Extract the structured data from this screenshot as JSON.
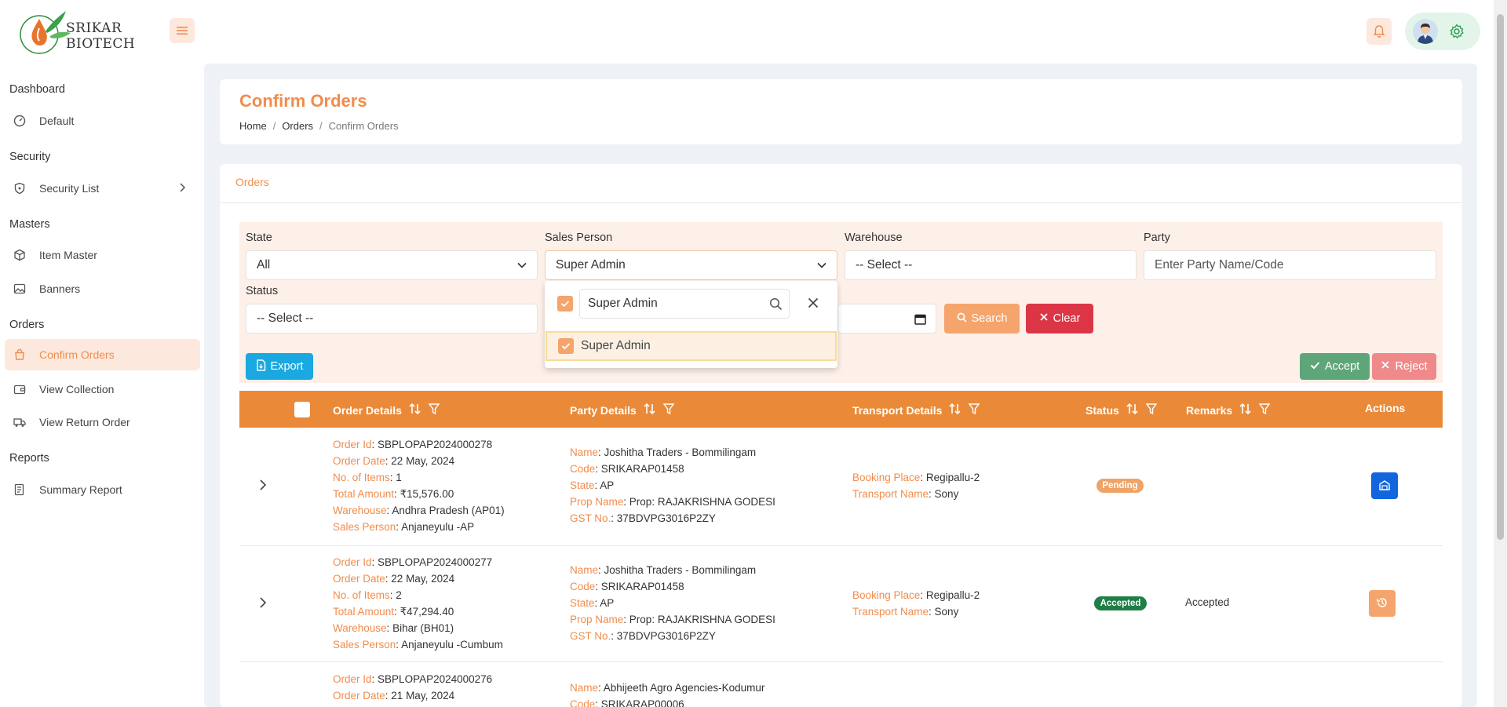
{
  "brand": {
    "line1": "SRIKAR",
    "line2": "BIOTECH"
  },
  "sidebar": {
    "sections": [
      {
        "title": "Dashboard",
        "items": [
          {
            "label": "Default",
            "icon": "gauge-icon"
          }
        ]
      },
      {
        "title": "Security",
        "items": [
          {
            "label": "Security List",
            "icon": "shield-icon"
          }
        ]
      },
      {
        "title": "Masters",
        "items": [
          {
            "label": "Item Master",
            "icon": "box-icon"
          },
          {
            "label": "Banners",
            "icon": "image-icon"
          }
        ]
      },
      {
        "title": "Orders",
        "items": [
          {
            "label": "Confirm Orders",
            "icon": "bag-icon"
          },
          {
            "label": "View Collection",
            "icon": "wallet-icon"
          },
          {
            "label": "View Return Order",
            "icon": "truck-icon"
          }
        ]
      },
      {
        "title": "Reports",
        "items": [
          {
            "label": "Summary Report",
            "icon": "report-icon"
          }
        ]
      }
    ]
  },
  "page": {
    "title": "Confirm Orders",
    "breadcrumb": [
      "Home",
      "Orders",
      "Confirm Orders"
    ],
    "card_title": "Orders"
  },
  "filters": {
    "state": {
      "label": "State",
      "value": "All"
    },
    "sales_person": {
      "label": "Sales Person",
      "value": "Super Admin"
    },
    "warehouse": {
      "label": "Warehouse",
      "value": "-- Select --"
    },
    "party": {
      "label": "Party",
      "placeholder": "Enter Party Name/Code"
    },
    "status": {
      "label": "Status",
      "value": "-- Select --"
    },
    "search_label": "Search",
    "clear_label": "Clear",
    "export_label": "Export",
    "accept_label": "Accept",
    "reject_label": "Reject"
  },
  "dropdown": {
    "search_value": "Super Admin",
    "option": "Super Admin"
  },
  "table": {
    "headers": {
      "order_details": "Order Details",
      "party_details": "Party Details",
      "transport_details": "Transport Details",
      "status": "Status",
      "remarks": "Remarks",
      "actions": "Actions"
    },
    "keys": {
      "order_id": "Order Id",
      "order_date": "Order Date",
      "no_items": "No. of Items",
      "total_amount": "Total Amount",
      "warehouse": "Warehouse",
      "sales_person": "Sales Person",
      "name": "Name",
      "code": "Code",
      "state": "State",
      "prop_name": "Prop Name",
      "gst_no": "GST No.",
      "booking_place": "Booking Place",
      "transport_name": "Transport Name"
    },
    "rows": [
      {
        "order_id": "SBPLOPAP2024000278",
        "order_date": "22 May, 2024",
        "no_items": "1",
        "total_amount": "₹15,576.00",
        "warehouse": "Andhra Pradesh (AP01)",
        "sales_person": "Anjaneyulu -AP",
        "name": "Joshitha Traders - Bommilingam",
        "code": "SRIKARAP01458",
        "state": "AP",
        "prop_name": "Prop: RAJAKRISHNA GODESI",
        "gst_no": "37BDVPG3016P2ZY",
        "booking_place": "Regipallu-2",
        "transport_name": "Sony",
        "status": "Pending",
        "remarks": ""
      },
      {
        "order_id": "SBPLOPAP2024000277",
        "order_date": "22 May, 2024",
        "no_items": "2",
        "total_amount": "₹47,294.40",
        "warehouse": "Bihar (BH01)",
        "sales_person": "Anjaneyulu -Cumbum",
        "name": "Joshitha Traders - Bommilingam",
        "code": "SRIKARAP01458",
        "state": "AP",
        "prop_name": "Prop: RAJAKRISHNA GODESI",
        "gst_no": "37BDVPG3016P2ZY",
        "booking_place": "Regipallu-2",
        "transport_name": "Sony",
        "status": "Accepted",
        "remarks": "Accepted"
      },
      {
        "order_id": "SBPLOPAP2024000276",
        "order_date": "21 May, 2024",
        "name": "Abhijeeth Agro Agencies-Kodumur",
        "code": "SRIKARAP00006"
      }
    ]
  },
  "colors": {
    "accent": "#f28c4b",
    "table_header": "#ea8a39",
    "pending": "#f0a366",
    "accepted": "#1e7e45",
    "search_btn": "#f5a46c",
    "clear_btn": "#dc3545",
    "export_btn": "#1aa8e0",
    "accept_btn": "#5fa57a",
    "reject_btn": "#f08a8a"
  }
}
